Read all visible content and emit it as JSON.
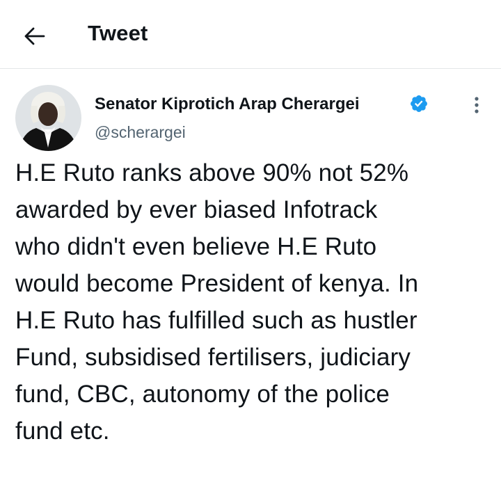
{
  "header": {
    "title": "Tweet",
    "back_icon": "arrow-left-icon"
  },
  "tweet": {
    "author_name": "Senator Kiprotich Arap Cherargei",
    "handle": "@scherargei",
    "verified": true,
    "verified_color": "#1d9bf0",
    "text": "H.E Ruto ranks above 90% not 52%\nawarded by ever biased Infotrack\nwho didn't even believe H.E Ruto\nwould become President of kenya. In\nH.E Ruto has fulfilled such as hustler\nFund, subsidised fertilisers, judiciary\nfund, CBC, autonomy of the police\nfund etc."
  },
  "colors": {
    "text": "#0f1419",
    "secondary": "#536471",
    "divider": "#e3e6e8"
  }
}
